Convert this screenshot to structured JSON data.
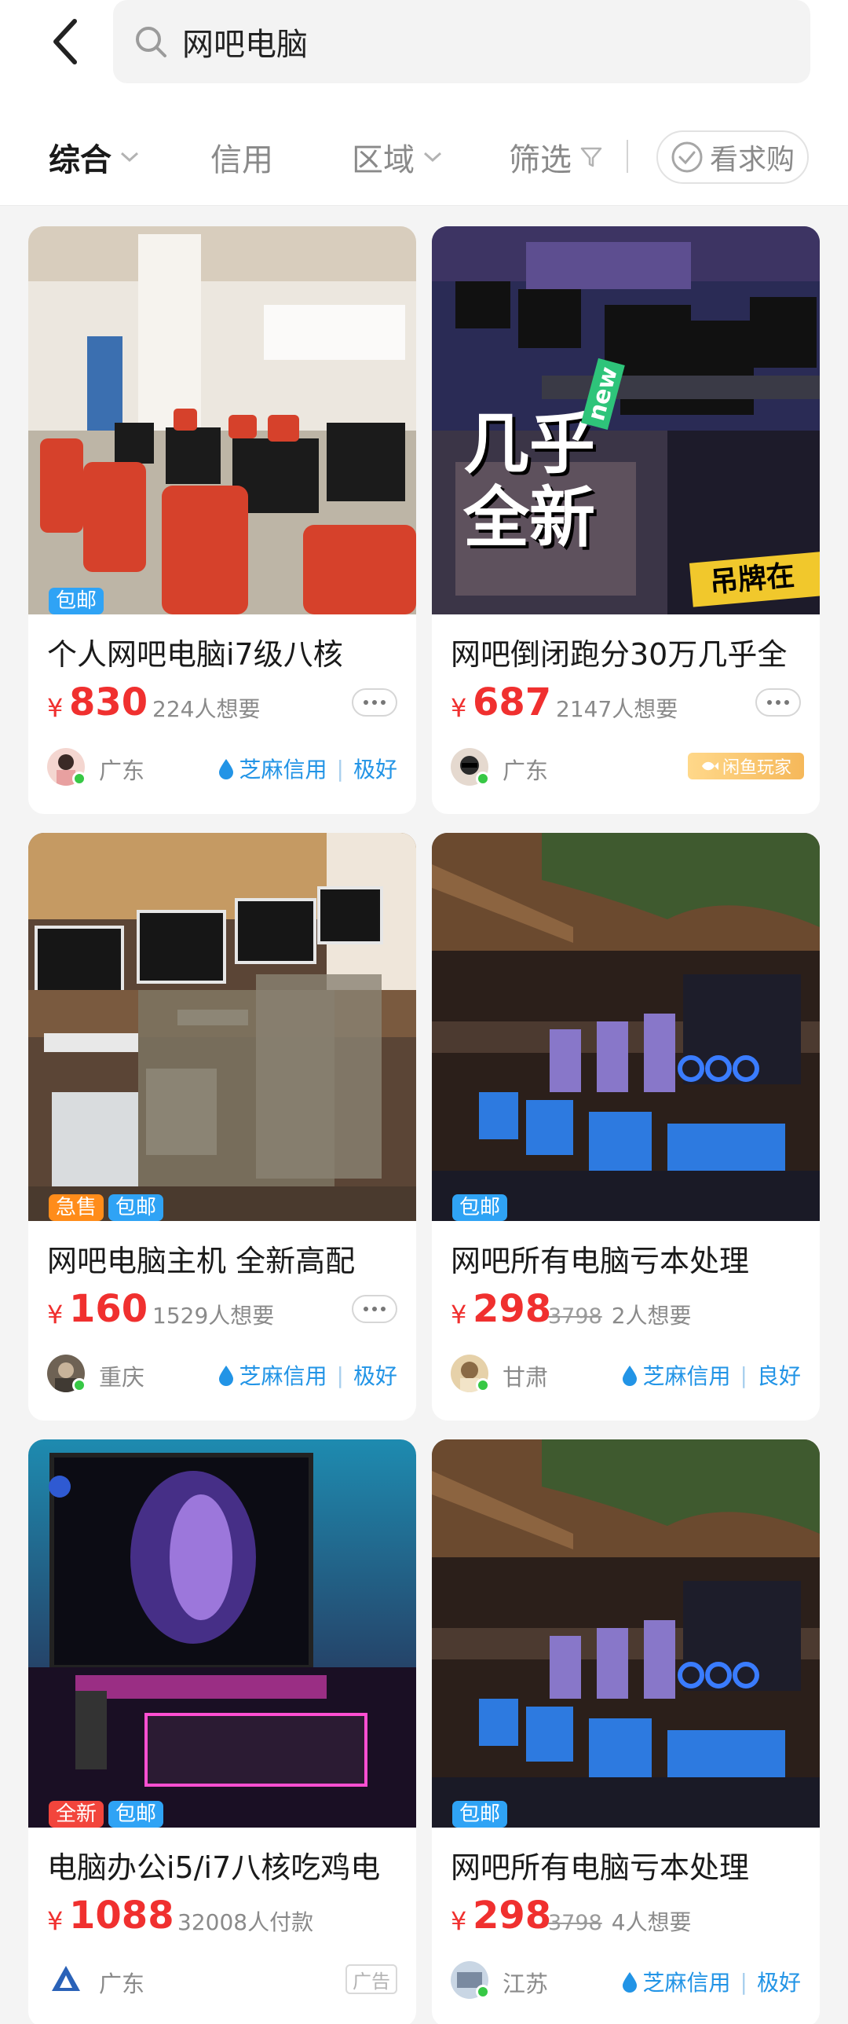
{
  "search": {
    "query": "网吧电脑"
  },
  "filters": {
    "items": [
      {
        "label": "综合",
        "active": true,
        "has_chevron": true
      },
      {
        "label": "信用",
        "active": false,
        "has_chevron": false
      },
      {
        "label": "区域",
        "active": false,
        "has_chevron": true
      },
      {
        "label": "筛选",
        "active": false,
        "has_chevron": false
      }
    ],
    "want_label": "看求购"
  },
  "products": [
    {
      "tags": [
        {
          "text": "包邮",
          "color": "#2fa3f5"
        }
      ],
      "title": "个人网吧电脑i7级八核",
      "currency": "¥",
      "price": "830",
      "original_price": "",
      "meta": "224人想要",
      "location": "广东",
      "credit": {
        "label": "芝麻信用",
        "level": "极好"
      },
      "badge": "",
      "ad_label": ""
    },
    {
      "tags": [],
      "title": "网吧倒闭跑分30万几乎全",
      "currency": "¥",
      "price": "687",
      "original_price": "",
      "meta": "2147人想要",
      "location": "广东",
      "credit": null,
      "badge": "闲鱼玩家",
      "ad_label": "",
      "image_text": {
        "line1": "几乎",
        "line2": "全新",
        "corner": "new",
        "banner": "吊牌在"
      }
    },
    {
      "tags": [
        {
          "text": "急售",
          "color": "#ff8c1a"
        },
        {
          "text": "包邮",
          "color": "#2fa3f5"
        }
      ],
      "title": "网吧电脑主机 全新高配",
      "currency": "¥",
      "price": "160",
      "original_price": "",
      "meta": "1529人想要",
      "location": "重庆",
      "credit": {
        "label": "芝麻信用",
        "level": "极好"
      },
      "badge": "",
      "ad_label": ""
    },
    {
      "tags": [
        {
          "text": "包邮",
          "color": "#2fa3f5"
        }
      ],
      "title": "网吧所有电脑亏本处理",
      "currency": "¥",
      "price": "298",
      "original_price": "3798",
      "meta": "2人想要",
      "location": "甘肃",
      "credit": {
        "label": "芝麻信用",
        "level": "良好"
      },
      "badge": "",
      "ad_label": ""
    },
    {
      "tags": [
        {
          "text": "全新",
          "color": "#f2453c"
        },
        {
          "text": "包邮",
          "color": "#2fa3f5"
        }
      ],
      "title": "电脑办公i5/i7八核吃鸡电",
      "currency": "¥",
      "price": "1088",
      "original_price": "",
      "meta": "32008人付款",
      "location": "广东",
      "credit": null,
      "badge": "",
      "ad_label": "广告"
    },
    {
      "tags": [
        {
          "text": "包邮",
          "color": "#2fa3f5"
        }
      ],
      "title": "网吧所有电脑亏本处理",
      "currency": "¥",
      "price": "298",
      "original_price": "3798",
      "meta": "4人想要",
      "location": "江苏",
      "credit": {
        "label": "芝麻信用",
        "level": "极好"
      },
      "badge": "",
      "ad_label": ""
    }
  ],
  "colors": {
    "price": "#f0302f",
    "credit": "#2294e6",
    "tag_blue": "#2fa3f5",
    "tag_orange": "#ff8c1a",
    "tag_red": "#f2453c"
  },
  "icons": {
    "back": "back-arrow-icon",
    "search": "search-icon",
    "filter": "funnel-icon",
    "check": "check-circle-icon",
    "more": "more-dots-icon",
    "credit": "flame-drop-icon"
  }
}
